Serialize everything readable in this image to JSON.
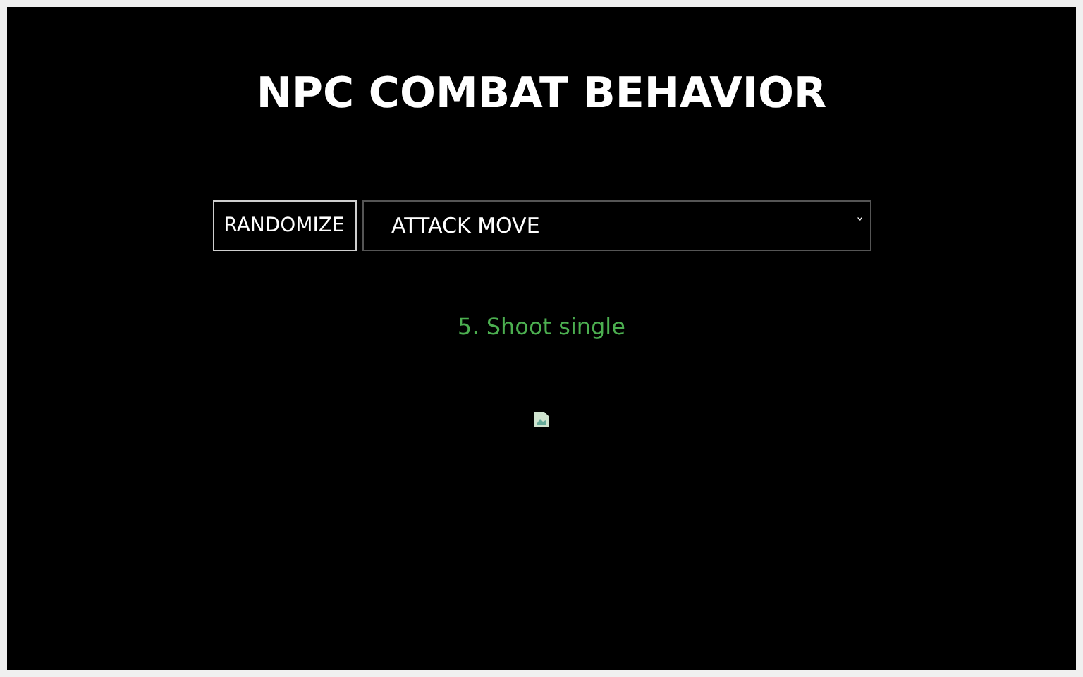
{
  "title": "NPC COMBAT BEHAVIOR",
  "randomize_button": {
    "label": "RANDOMIZE"
  },
  "behavior_select": {
    "value": "ATTACK MOVE",
    "caret": "ˇ"
  },
  "result": {
    "text": "5. Shoot single"
  }
}
